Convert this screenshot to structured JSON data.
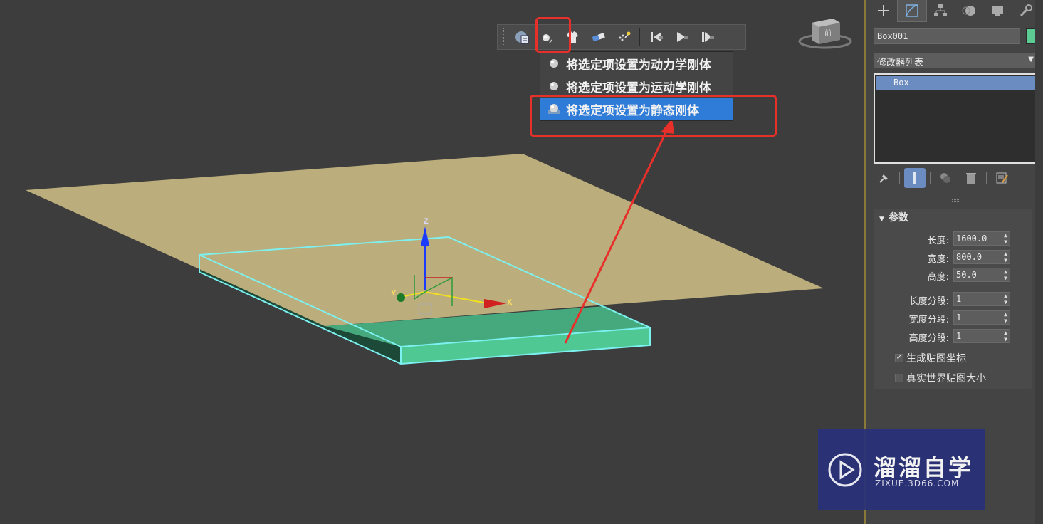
{
  "toolbar": {
    "buttons": [
      {
        "name": "mass-fx-world-icon"
      },
      {
        "name": "rigid-body-icon"
      },
      {
        "name": "mcloth-icon"
      },
      {
        "name": "constraint-icon"
      },
      {
        "name": "particle-icon"
      },
      {
        "name": "reset-simulation-icon"
      },
      {
        "name": "play-simulation-icon"
      },
      {
        "name": "step-simulation-icon"
      }
    ]
  },
  "rigid_body_menu": {
    "items": [
      {
        "label": "将选定项设置为动力学刚体",
        "selected": false
      },
      {
        "label": "将选定项设置为运动学刚体",
        "selected": false
      },
      {
        "label": "将选定项设置为静态刚体",
        "selected": true
      }
    ]
  },
  "command_panel": {
    "object_name": "Box001",
    "object_color": "#5ccc94",
    "modifier_list_label": "修改器列表",
    "stack": [
      "Box"
    ],
    "rollout_title": "参数",
    "params": [
      {
        "label": "长度:",
        "value": "1600.0"
      },
      {
        "label": "宽度:",
        "value": "800.0"
      },
      {
        "label": "高度:",
        "value": "50.0"
      },
      {
        "label": "长度分段:",
        "value": "1"
      },
      {
        "label": "宽度分段:",
        "value": "1"
      },
      {
        "label": "高度分段:",
        "value": "1"
      }
    ],
    "checks": [
      {
        "label": "生成贴图坐标",
        "checked": true
      },
      {
        "label": "真实世界贴图大小",
        "checked": false
      }
    ]
  },
  "gizmo": {
    "x": "X",
    "y": "Y",
    "z": "Z"
  },
  "viewcube": {
    "face": "前"
  },
  "watermark": {
    "title": "溜溜自学",
    "url": "ZIXUE.3D66.COM"
  },
  "colors": {
    "accent": "#e8302a",
    "selection": "#2f7cd8",
    "plane": "#bcae7c",
    "box": "#4fc894"
  }
}
